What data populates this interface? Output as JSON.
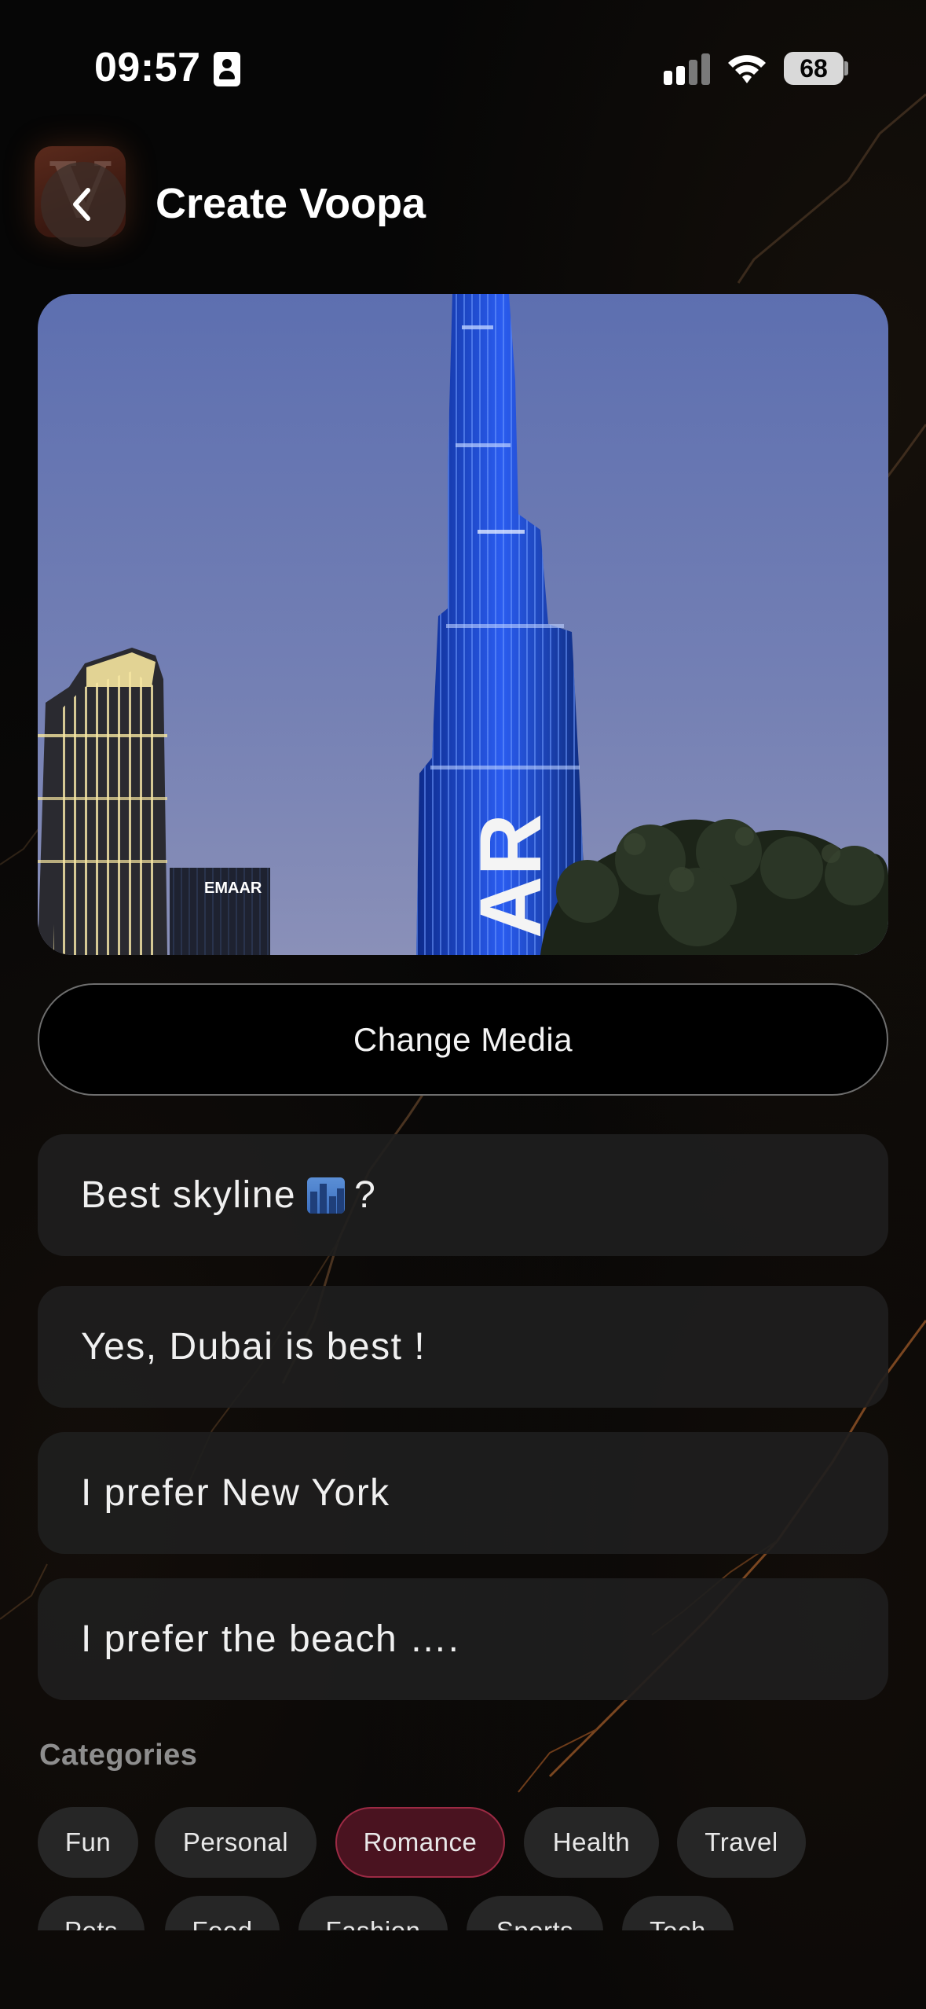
{
  "status_bar": {
    "time": "09:57",
    "battery": "68",
    "icons": [
      "contact-card-icon",
      "signal-icon",
      "wifi-icon",
      "battery-icon"
    ]
  },
  "header": {
    "title": "Create Voopa",
    "logo_letter": "V",
    "back_icon": "chevron-left-icon"
  },
  "media": {
    "description_icon": "photo",
    "sign_emaar_small": "EMAAR",
    "sign_emaar_tower": "EMAAR",
    "tower_lettering": "AR"
  },
  "change_media_label": "Change Media",
  "question": {
    "text_before": "Best skyline",
    "emoji": "cityscape-emoji",
    "text_after": "?"
  },
  "answers": [
    "Yes, Dubai is best !",
    "I prefer New York",
    "I prefer the beach …."
  ],
  "categories": {
    "label": "Categories",
    "row1": [
      "Fun",
      "Personal",
      "Romance",
      "Health",
      "Travel"
    ],
    "row2": [
      "Pets",
      "Food",
      "Fashion",
      "Sports",
      "Tech"
    ],
    "selected": "Romance"
  },
  "colors": {
    "background": "#060606",
    "field": "#1e1e1e",
    "chip": "#262626",
    "chip_selected": "#4a1320",
    "chip_selected_border": "#9c2a44"
  }
}
